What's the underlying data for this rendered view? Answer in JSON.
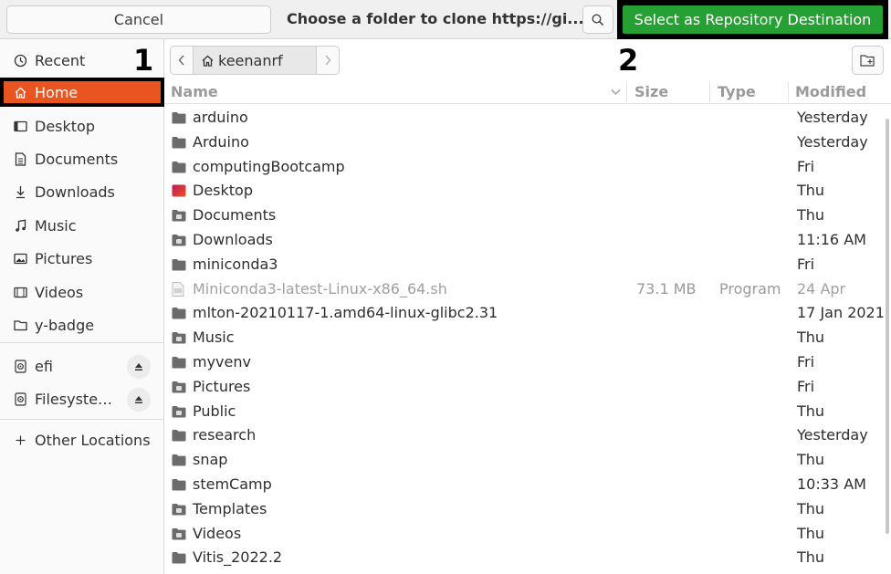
{
  "header": {
    "cancel_label": "Cancel",
    "title": "Choose a folder to clone https://gi...",
    "select_label": "Select as Repository Destination",
    "search_icon": "search-icon"
  },
  "annotations": {
    "a1": "1",
    "a2": "2"
  },
  "sidebar": {
    "items": [
      {
        "label": "Recent",
        "icon": "clock-icon"
      },
      {
        "label": "Home",
        "icon": "home-icon"
      },
      {
        "label": "Desktop",
        "icon": "desktop-icon"
      },
      {
        "label": "Documents",
        "icon": "document-icon"
      },
      {
        "label": "Downloads",
        "icon": "download-icon"
      },
      {
        "label": "Music",
        "icon": "music-icon"
      },
      {
        "label": "Pictures",
        "icon": "picture-icon"
      },
      {
        "label": "Videos",
        "icon": "video-icon"
      },
      {
        "label": "y-badge",
        "icon": "folder-icon"
      }
    ],
    "drives": [
      {
        "label": "efi",
        "icon": "drive-icon"
      },
      {
        "label": "Filesyste…",
        "icon": "drive-icon"
      }
    ],
    "other_locations": "Other Locations"
  },
  "pathbar": {
    "home_label": "keenanrf"
  },
  "columns": {
    "name": "Name",
    "size": "Size",
    "type": "Type",
    "modified": "Modified"
  },
  "files": [
    {
      "name": "arduino",
      "size": "",
      "type": "",
      "modified": "Yesterday",
      "kind": "folder"
    },
    {
      "name": "Arduino",
      "size": "",
      "type": "",
      "modified": "Yesterday",
      "kind": "folder"
    },
    {
      "name": "computingBootcamp",
      "size": "",
      "type": "",
      "modified": "Fri",
      "kind": "folder"
    },
    {
      "name": "Desktop",
      "size": "",
      "type": "",
      "modified": "Thu",
      "kind": "desktop"
    },
    {
      "name": "Documents",
      "size": "",
      "type": "",
      "modified": "Thu",
      "kind": "folder"
    },
    {
      "name": "Downloads",
      "size": "",
      "type": "",
      "modified": "11:16 AM",
      "kind": "folder"
    },
    {
      "name": "miniconda3",
      "size": "",
      "type": "",
      "modified": "Fri",
      "kind": "folder"
    },
    {
      "name": "Miniconda3-latest-Linux-x86_64.sh",
      "size": "73.1 MB",
      "type": "Program",
      "modified": "24 Apr",
      "kind": "file"
    },
    {
      "name": "mlton-20210117-1.amd64-linux-glibc2.31",
      "size": "",
      "type": "",
      "modified": "17 Jan 2021",
      "kind": "folder"
    },
    {
      "name": "Music",
      "size": "",
      "type": "",
      "modified": "Thu",
      "kind": "folder"
    },
    {
      "name": "myvenv",
      "size": "",
      "type": "",
      "modified": "Fri",
      "kind": "folder"
    },
    {
      "name": "Pictures",
      "size": "",
      "type": "",
      "modified": "Fri",
      "kind": "folder"
    },
    {
      "name": "Public",
      "size": "",
      "type": "",
      "modified": "Thu",
      "kind": "folder"
    },
    {
      "name": "research",
      "size": "",
      "type": "",
      "modified": "Yesterday",
      "kind": "folder"
    },
    {
      "name": "snap",
      "size": "",
      "type": "",
      "modified": "Thu",
      "kind": "folder"
    },
    {
      "name": "stemCamp",
      "size": "",
      "type": "",
      "modified": "10:33 AM",
      "kind": "folder"
    },
    {
      "name": "Templates",
      "size": "",
      "type": "",
      "modified": "Thu",
      "kind": "folder"
    },
    {
      "name": "Videos",
      "size": "",
      "type": "",
      "modified": "Thu",
      "kind": "folder"
    },
    {
      "name": "Vitis_2022.2",
      "size": "",
      "type": "",
      "modified": "Thu",
      "kind": "folder"
    }
  ],
  "colors": {
    "accent": "#e95420",
    "select_button": "#26a033",
    "folder": "#6b6b6b"
  }
}
